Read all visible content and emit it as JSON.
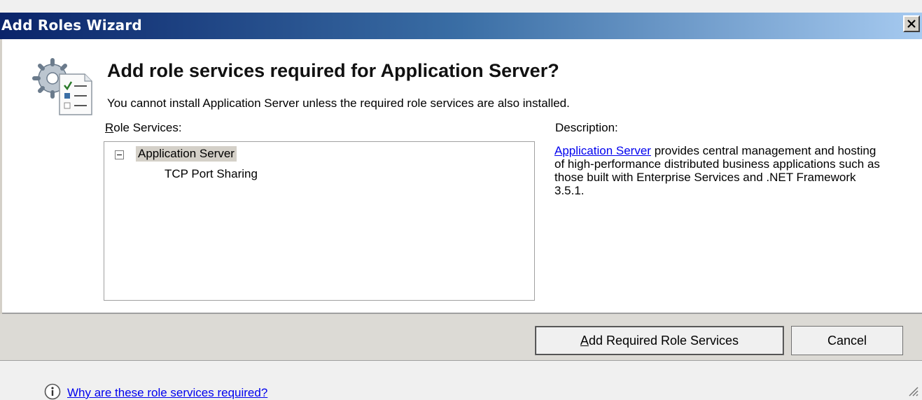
{
  "window": {
    "title": "Add Roles Wizard",
    "close_icon": "close-icon"
  },
  "dialog": {
    "heading": "Add role services required for Application Server?",
    "subtitle": "You cannot install Application Server unless the required role services are also installed.",
    "role_services_label_key": "R",
    "role_services_label_rest": "ole Services:",
    "description_label": "Description:",
    "tree": {
      "root": "Application Server",
      "root_expanded": true,
      "children": [
        "TCP Port Sharing"
      ]
    },
    "description": {
      "link": "Application Server",
      "text": " provides central management and hosting of high-performance distributed business applications such as those built with Enterprise Services and .NET Framework 3.5.1."
    }
  },
  "buttons": {
    "add_key": "A",
    "add_rest": "dd Required Role Services",
    "cancel": "Cancel"
  },
  "footer": {
    "help_link": "Why are these role services required?",
    "info_icon": "info-icon"
  },
  "colors": {
    "titlebar_start": "#0a246a",
    "titlebar_end": "#a6caf0",
    "link": "#0000ee"
  }
}
